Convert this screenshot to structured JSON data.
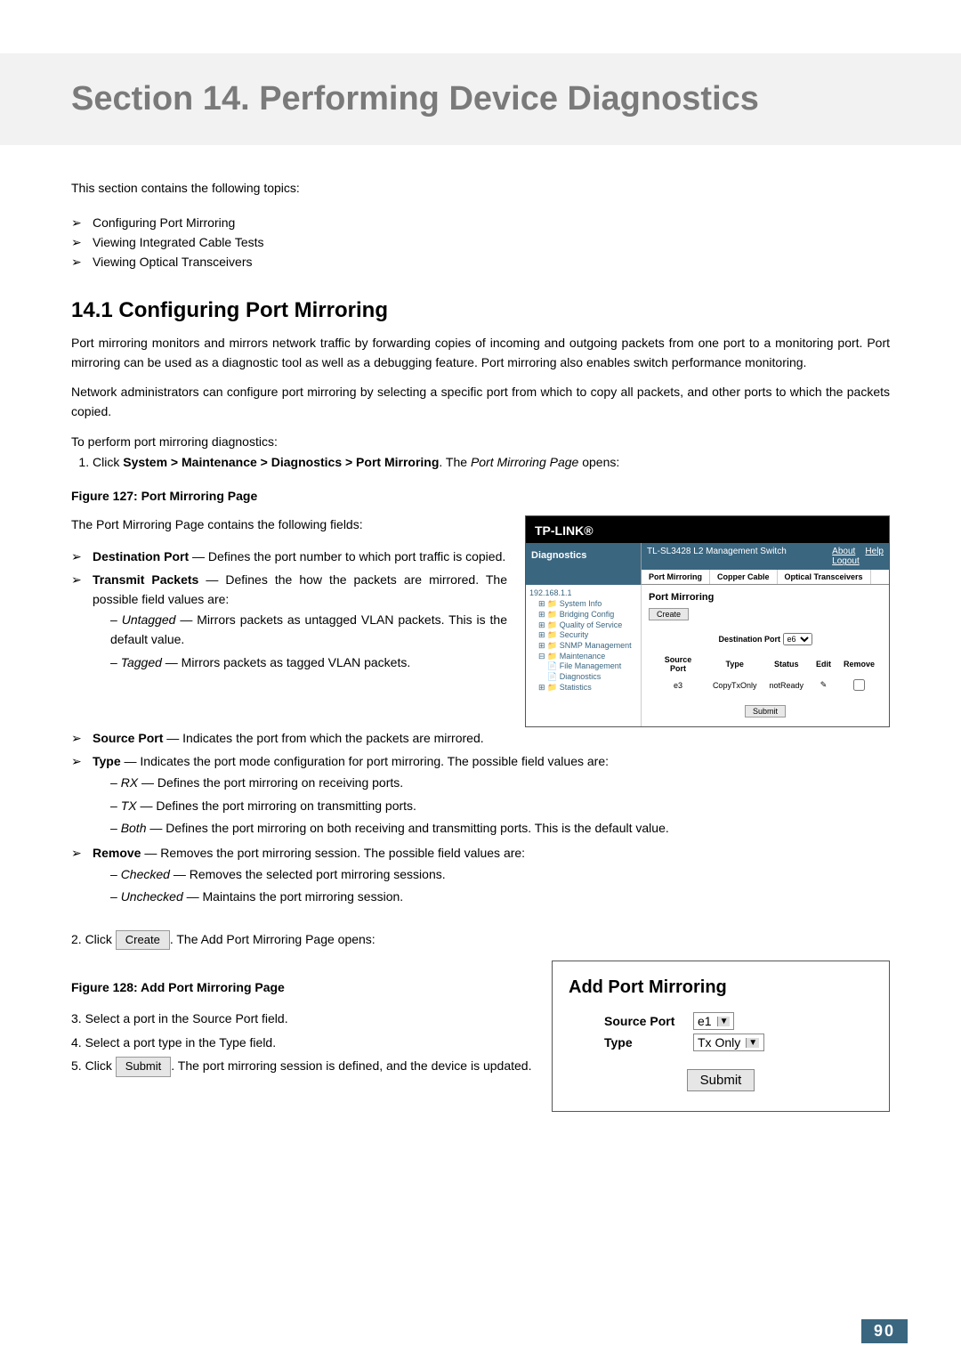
{
  "section_title": "Section 14.  Performing Device Diagnostics",
  "intro": "This section contains the following topics:",
  "topics": [
    "Configuring Port Mirroring",
    "Viewing Integrated Cable Tests",
    "Viewing Optical Transceivers"
  ],
  "subsection_heading": "14.1   Configuring Port Mirroring",
  "para1": "Port mirroring monitors and mirrors network traffic by forwarding copies of incoming and outgoing packets from one port to a monitoring port. Port mirroring can be used as a diagnostic tool as well as a debugging feature. Port mirroring also enables switch performance monitoring.",
  "para2": "Network administrators can configure port mirroring by selecting a specific port from which to copy all packets, and other ports to which the packets copied.",
  "para3": "To perform port mirroring diagnostics:",
  "step1_prefix": "Click ",
  "step1_bold": "System > Maintenance > Diagnostics > Port Mirroring",
  "step1_mid": ". The ",
  "step1_italic": "Port Mirroring Page",
  "step1_suffix": " opens:",
  "figure127_label": "Figure 127: Port Mirroring Page",
  "fields_intro": "The Port Mirroring Page contains the following fields:",
  "field_dest_port_term": "Destination Port",
  "field_dest_port_desc": " — Defines the port number to which port traffic is copied.",
  "field_transmit_term": "Transmit Packets",
  "field_transmit_desc": " — Defines the how the packets are mirrored. The possible field values are:",
  "transmit_untagged_term": "Untagged",
  "transmit_untagged_desc": " — Mirrors packets as untagged VLAN packets. This is the default value.",
  "transmit_tagged_term": "Tagged",
  "transmit_tagged_desc": " — Mirrors packets as tagged VLAN packets.",
  "field_source_term": "Source Port",
  "field_source_desc": " — Indicates the port from which the packets are mirrored.",
  "field_type_term": "Type",
  "field_type_desc": " — Indicates the port mode configuration for port mirroring. The possible field values are:",
  "type_rx_term": "RX",
  "type_rx_desc": " — Defines the port mirroring on receiving ports.",
  "type_tx_term": "TX",
  "type_tx_desc": " — Defines the port mirroring on transmitting ports.",
  "type_both_term": "Both",
  "type_both_desc": " — Defines the port mirroring on both receiving and transmitting ports. This is the default value.",
  "field_remove_term": "Remove",
  "field_remove_desc": " — Removes the port mirroring session. The possible field values are:",
  "remove_checked_term": "Checked",
  "remove_checked_desc": " — Removes the selected port mirroring sessions.",
  "remove_unchecked_term": "Unchecked",
  "remove_unchecked_desc": " — Maintains the port mirroring session.",
  "step2_prefix": "2. Click ",
  "step2_btn": "Create",
  "step2_suffix": ". The Add Port Mirroring Page opens:",
  "figure128_label": "Figure 128: Add Port Mirroring Page",
  "step3": "3.   Select a port in the Source Port field.",
  "step4": "4.   Select a port type in the Type field.",
  "step5_prefix": "5.   Click ",
  "step5_btn": "Submit",
  "step5_suffix": ". The port mirroring session is defined, and the device is updated.",
  "ui": {
    "brand": "TP-LINK®",
    "diag_label": "Diagnostics",
    "switch_label": "TL-SL3428 L2 Management Switch",
    "about": "About",
    "help": "Help",
    "logout": "Logout",
    "tabs": [
      "Port Mirroring",
      "Copper Cable",
      "Optical Transceivers"
    ],
    "tree_ip": "192.168.1.1",
    "tree_items": [
      "System Info",
      "Bridging Config",
      "Quality of Service",
      "Security",
      "SNMP Management",
      "Maintenance",
      "File Management",
      "Diagnostics",
      "Statistics"
    ],
    "panel_title": "Port Mirroring",
    "create_btn": "Create",
    "dest_port_label": "Destination Port",
    "dest_port_value": "e6",
    "cols": [
      "Source Port",
      "Type",
      "Status",
      "Edit",
      "Remove"
    ],
    "row": {
      "port": "e3",
      "type": "CopyTxOnly",
      "status": "notReady"
    },
    "submit": "Submit"
  },
  "add": {
    "title": "Add Port Mirroring",
    "source_port_label": "Source Port",
    "source_port_value": "e1",
    "type_label": "Type",
    "type_value": "Tx Only",
    "submit": "Submit"
  },
  "page_number": "90"
}
